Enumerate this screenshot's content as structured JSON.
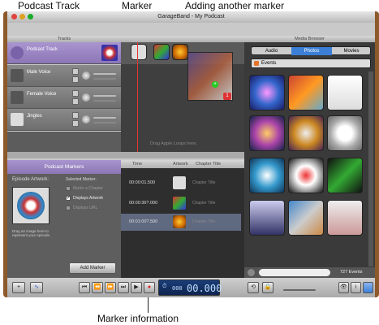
{
  "callouts": {
    "podcast_track": "Podcast Track",
    "marker": "Marker",
    "adding_marker": "Adding another marker",
    "marker_information": "Marker information"
  },
  "window": {
    "title": "GarageBand - My Podcast"
  },
  "tracks": {
    "header": "Tracks",
    "items": [
      {
        "label": "Podcast Track"
      },
      {
        "label": "Male Voice"
      },
      {
        "label": "Female Voice"
      },
      {
        "label": "Jingles"
      }
    ]
  },
  "timeline": {
    "drop_hint": "Drag Apple Loops here.",
    "badge": "1"
  },
  "media_browser": {
    "header": "Media Browser",
    "tabs": [
      "Audio",
      "Photos",
      "Movies"
    ],
    "selected_tab": "Photos",
    "source": "Events",
    "count": "727 Events"
  },
  "podcast_markers": {
    "header": "Podcast Markers",
    "episode_artwork_label": "Episode Artwork:",
    "artwork_hint": "Drag an image here to represent your episode.",
    "selected_marker_label": "Selected Marker:",
    "checkboxes": [
      {
        "label": "Marks a Chapter",
        "checked": false
      },
      {
        "label": "Displays Artwork",
        "checked": true
      },
      {
        "label": "Displays URL",
        "checked": false
      }
    ],
    "add_button": "Add Marker",
    "columns": [
      "Time",
      "Artwork",
      "Chapter Title"
    ],
    "rows": [
      {
        "time": "00:00:01.500",
        "title": "Chapter Title"
      },
      {
        "time": "00:00:36?.000",
        "title": "Chapter Title"
      },
      {
        "time": "00:01:00?.500",
        "title": "Chapter Title"
      }
    ]
  },
  "transport": {
    "lcd_time": "00.000",
    "lcd_small": "000"
  },
  "colors": {
    "accent_purple": "#9b7fc2",
    "wood": "#8d5a2b",
    "lcd_blue": "#1e5fa8"
  }
}
